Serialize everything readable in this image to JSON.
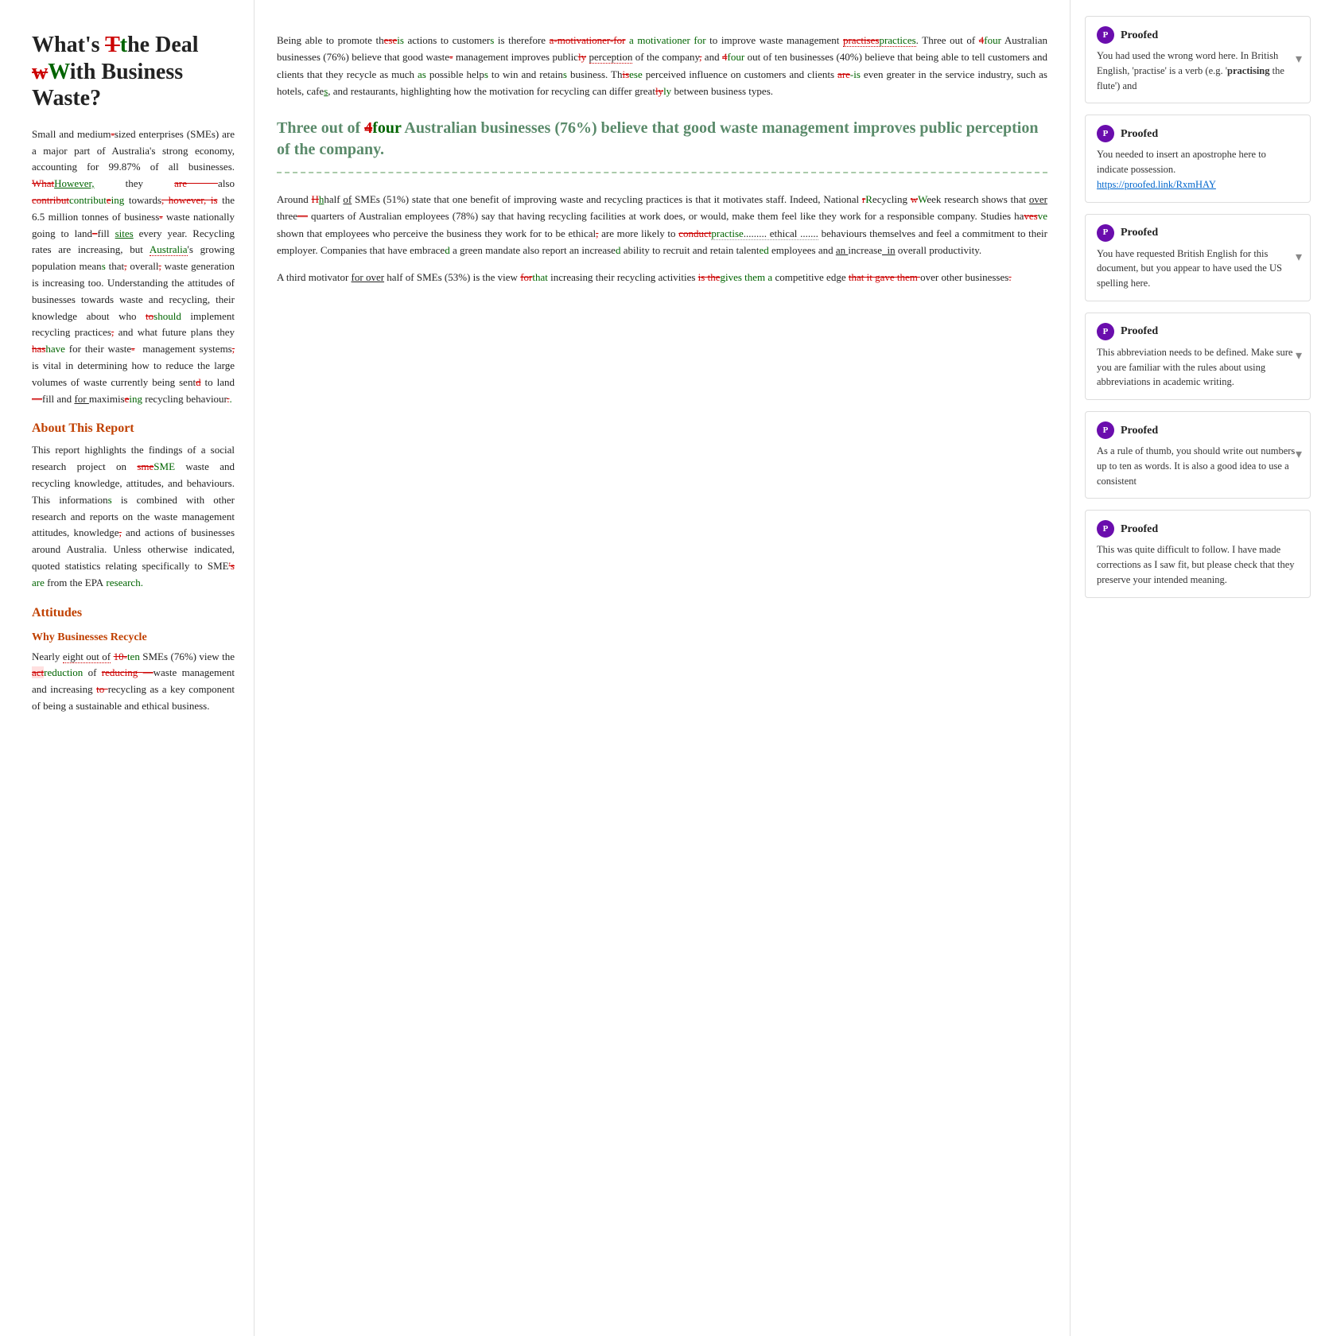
{
  "left": {
    "title_parts": [
      {
        "text": "What's ",
        "type": "normal"
      },
      {
        "text": "T",
        "type": "strike"
      },
      {
        "text": "t",
        "type": "normal"
      },
      {
        "text": "he Deal"
      },
      {
        "text": "w",
        "type": "strike"
      },
      {
        "text": "W",
        "type": "normal"
      },
      {
        "text": "ith Business Waste?"
      }
    ],
    "title_display": "What's T̶t̶he Deal w̶W̶ith Business Waste?",
    "intro": "Small and medium-sized enterprises (SMEs) are a major part of Australia's strong economy, accounting for 99.87% of all businesses. WhatHowever, they are also contributeing towards, however, is the 6.5 million tonnes of business- waste nationally going to land–fill sites every year. Recycling rates are increasing, but Australia's growing population means that, overall, waste generation is increasing too. Understanding the attitudes of businesses towards waste and recycling, their knowledge about who toshould implement recycling practices, and what future plans they hashave for their waste-  management systems, is vital in determining how to reduce the large volumes of waste currently being sentd to land—fill and for maximisinge recycling behaviour.",
    "about_heading": "About This Report",
    "about_text": "This report highlights the findings of a social research project on smeSME waste and recycling knowledge, attitudes, and behaviours. This informations is combined with other research and reports on the waste management attitudes, knowledge, and actions of businesses around Australia. Unless otherwise indicated, quoted statistics relating specifically to SME's are from the EPA research.",
    "attitudes_heading": "Attitudes",
    "why_heading": "Why Businesses Recycle",
    "why_text": "Nearly eight out of 10-ten SMEs (76%) view the actreduction of reducing waste management and increasing to recycling as a key component of being a sustainable and ethical business."
  },
  "middle": {
    "p1": "Being able to promote theseis actions to customers is therefore a-motivationer-for to improve waste management practisespractices. Three out of 4four Australian businesses (76%) believe that good waste- management improves publicly perception of the company, and 4four out of ten businesses (40%) believe that being able to tell customers and clients that they recycle as much as possible helps to win and retains business. Thisese perceived influence on customers and clients are-is even greater in the service industry, such as hotels, cafes, and restaurants, highlighting how the motivation for recycling can differ greatly between business types.",
    "quote": "Three out of 4four Australian businesses (76%) believe that good waste management improves public perception of the company.",
    "p2": "Around Hhalf of SMEs (51%) state that one benefit of improving waste and recycling practices is that it motivates staff. Indeed, National rRecycling wWeek research shows that over three—quarters of Australian employees (78%) say that having recycling facilities at work does, or would, make them feel like they work for a responsible company. Studies haves shown that employees who perceive the business they work for to be ethical, are more likely to conductpractise......... ethical ........ behaviours themselves and feel a commitment to their employer. Companies that have embraced a green mandate also report an increased ability to recruit and retain talented employees and an increase  in overall productivity.",
    "p3": "A third motivator for over half of SMEs (53%) is the view forthat increasing their recycling activities is thegives them a competitive edge that it gave them over other businesses."
  },
  "proofs": [
    {
      "id": "proof1",
      "title": "Proofed",
      "text": "You had used the wrong word here. In British English, 'practise' is a verb (e.g. 'practising the flute') and",
      "has_chevron": true,
      "has_link": false
    },
    {
      "id": "proof2",
      "title": "Proofed",
      "text": "You needed to insert an apostrophe here to indicate possession.",
      "link": "https://proofed.link/RxmHAY",
      "has_chevron": false,
      "has_link": true
    },
    {
      "id": "proof3",
      "title": "Proofed",
      "text": "You have requested British English for this document, but you appear to have used the US spelling here.",
      "has_chevron": true,
      "has_link": false
    },
    {
      "id": "proof4",
      "title": "Proofed",
      "text": "This abbreviation needs to be defined. Make sure you are familiar with the rules about using abbreviations in academic writing.",
      "has_chevron": true,
      "has_link": false
    },
    {
      "id": "proof5",
      "title": "Proofed",
      "text": "As a rule of thumb, you should write out numbers up to ten as words. It is also a good idea to use a consistent",
      "has_chevron": true,
      "has_link": false
    },
    {
      "id": "proof6",
      "title": "Proofed",
      "text": "This was quite difficult to follow. I have made corrections as I saw fit, but please check that they preserve your intended meaning.",
      "has_chevron": false,
      "has_link": false
    }
  ]
}
